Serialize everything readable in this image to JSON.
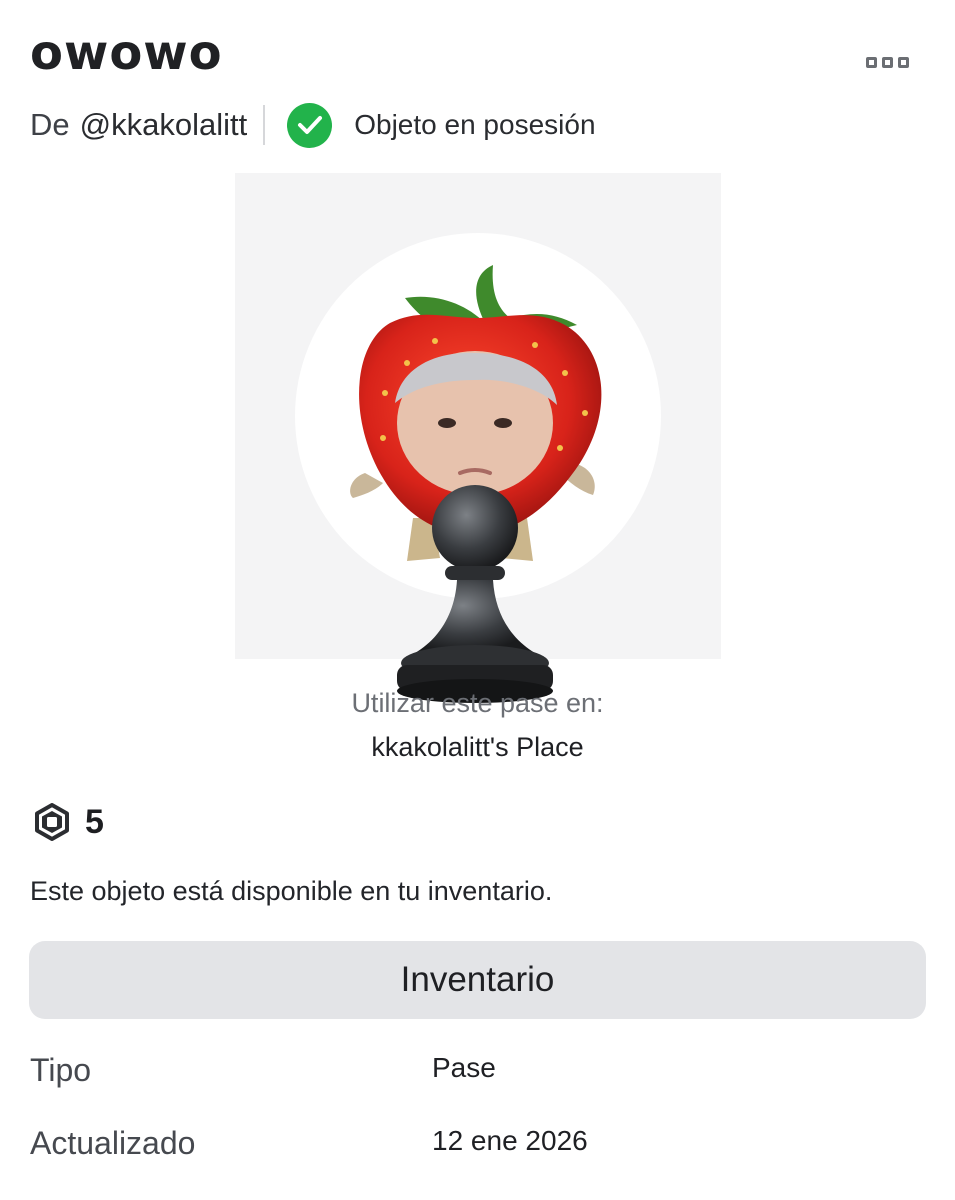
{
  "header": {
    "title": "owowo",
    "more_icon": "more-options-icon"
  },
  "byline": {
    "prefix": "De",
    "creator": "@kkakolalitt",
    "owned_icon": "checkmark-circle-icon",
    "owned_color": "#22b34b",
    "owned_label": "Objeto en posesión"
  },
  "thumbnail": {
    "description_icon": "item-thumbnail"
  },
  "usage": {
    "label": "Utilizar este pase en:",
    "place": "kkakolalitt's Place"
  },
  "price": {
    "currency_icon": "robux-icon",
    "amount": "5"
  },
  "availability": {
    "text": "Este objeto está disponible en tu inventario."
  },
  "actions": {
    "inventory_label": "Inventario"
  },
  "details": [
    {
      "label": "Tipo",
      "value": "Pase"
    },
    {
      "label": "Actualizado",
      "value": "12 ene 2026"
    }
  ]
}
